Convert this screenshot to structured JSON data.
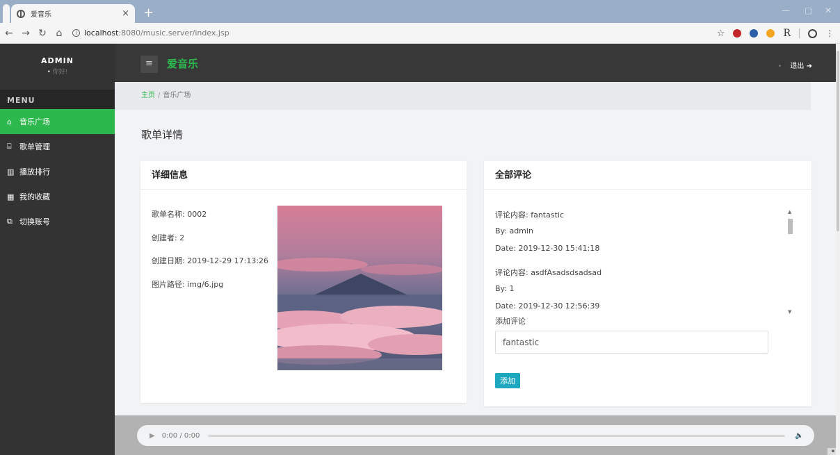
{
  "browser": {
    "tab_title": "爱音乐",
    "tab_close": "×",
    "new_tab": "+",
    "url_host": "localhost",
    "url_path": ":8080/music.server/index.jsp",
    "win_min": "—",
    "win_max": "▢",
    "win_close": "✕"
  },
  "sidebar": {
    "user_name": "ADMIN",
    "greeting": "你好!",
    "menu_title": "MENU",
    "items": [
      {
        "label": "音乐广场",
        "icon": "home-icon",
        "glyph": "⌂"
      },
      {
        "label": "歌单管理",
        "icon": "bank-icon",
        "glyph": "⌸"
      },
      {
        "label": "播放排行",
        "icon": "bar-chart-icon",
        "glyph": "▥"
      },
      {
        "label": "我的收藏",
        "icon": "grid-icon",
        "glyph": "▦"
      },
      {
        "label": "切换账号",
        "icon": "switch-icon",
        "glyph": "⧉"
      }
    ]
  },
  "topbar": {
    "menu_glyph": "≡",
    "brand": "爱音乐",
    "logout": "退出"
  },
  "breadcrumb": {
    "home": "主页",
    "separator": "/",
    "current": "音乐广场"
  },
  "page_title": "歌单详情",
  "detail": {
    "heading": "详细信息",
    "name": "歌单名称: 0002",
    "creator": "创建者: 2",
    "created": "创建日期: 2019-12-29 17:13:26",
    "image_path": "图片路径: img/6.jpg"
  },
  "comments": {
    "heading": "全部评论",
    "list": [
      {
        "content": "评论内容: fantastic",
        "by": "By:  admin",
        "date": "Date:  2019-12-30 15:41:18"
      },
      {
        "content": "评论内容: asdfAsadsdsadsad",
        "by": "By:  1",
        "date": "Date:  2019-12-30 12:56:39"
      }
    ],
    "add_label": "添加评论",
    "input_value": "fantastic",
    "add_button": "添加"
  },
  "player": {
    "time": "0:00 / 0:00"
  },
  "colors": {
    "accent_green": "#2db84d",
    "button_blue": "#1ea8c0",
    "sidebar_bg": "#333333"
  }
}
